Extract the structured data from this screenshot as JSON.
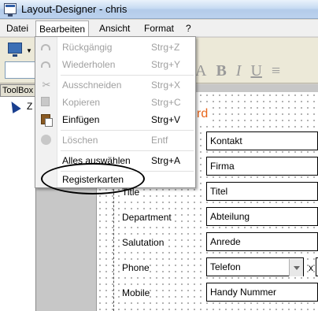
{
  "window": {
    "title": "Layout-Designer - chris",
    "icon": "monitor-icon"
  },
  "menubar": {
    "items": [
      {
        "label": "Datei",
        "mnemonic": "D"
      },
      {
        "label": "Bearbeiten",
        "mnemonic": "B"
      },
      {
        "label": "Ansicht",
        "mnemonic": "A"
      },
      {
        "label": "Format",
        "mnemonic": "F"
      },
      {
        "label": "?",
        "mnemonic": "?"
      }
    ]
  },
  "toolbox": {
    "title": "ToolBox",
    "item_label": "Z"
  },
  "format_icons": [
    "A",
    "B",
    "I",
    "U"
  ],
  "edit_menu": {
    "items": [
      {
        "label": "Rückgängig",
        "shortcut": "Strg+Z",
        "enabled": false,
        "icon": "undo-icon"
      },
      {
        "label": "Wiederholen",
        "shortcut": "Strg+Y",
        "enabled": false,
        "icon": "redo-icon"
      },
      {
        "label": "Ausschneiden",
        "shortcut": "Strg+X",
        "enabled": false,
        "icon": "cut-icon"
      },
      {
        "label": "Kopieren",
        "shortcut": "Strg+C",
        "enabled": false,
        "icon": "copy-icon"
      },
      {
        "label": "Einfügen",
        "shortcut": "Strg+V",
        "enabled": true,
        "icon": "paste-icon"
      },
      {
        "label": "Löschen",
        "shortcut": "Entf",
        "enabled": false,
        "icon": "delete-icon"
      },
      {
        "label": "Alles auswählen",
        "shortcut": "Strg+A",
        "enabled": true,
        "icon": ""
      },
      {
        "label": "Registerkarten",
        "shortcut": "",
        "enabled": true,
        "icon": ""
      }
    ]
  },
  "designer": {
    "heading_fragment": "rd",
    "fields": [
      {
        "label": "",
        "value": "Kontakt"
      },
      {
        "label": "",
        "value": "Firma"
      },
      {
        "label": "Title",
        "value": "Titel"
      },
      {
        "label": "Department",
        "value": "Abteilung"
      },
      {
        "label": "Salutation",
        "value": "Anrede"
      },
      {
        "label": "Phone",
        "value": "Telefon"
      },
      {
        "label": "Mobile",
        "value": "Handy Nummer"
      }
    ],
    "phone_extra_label": "x"
  },
  "colors": {
    "heading": "#e8651a",
    "accent": "#2f5ea8"
  }
}
